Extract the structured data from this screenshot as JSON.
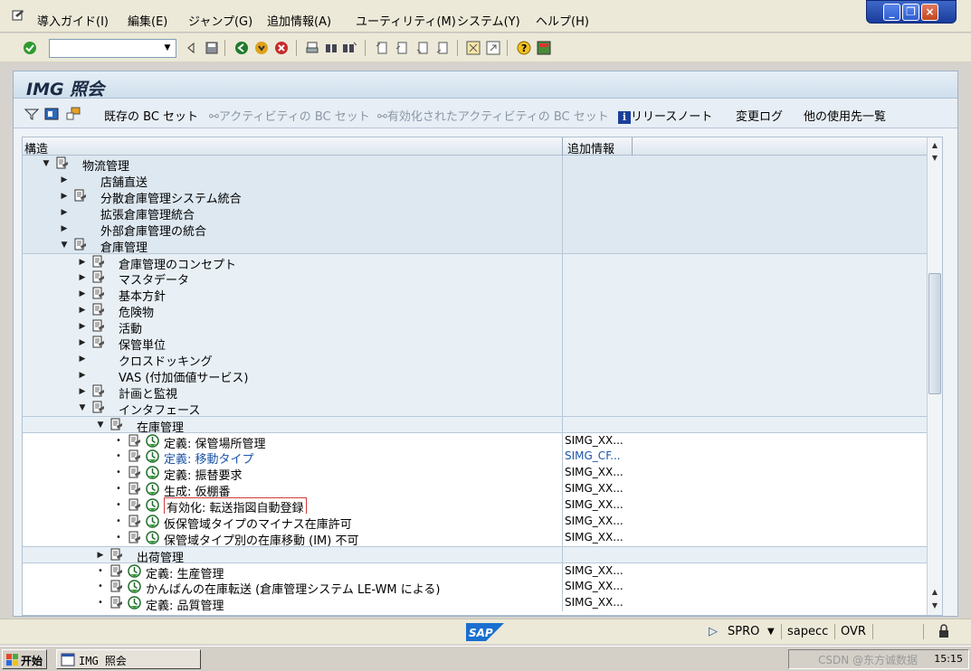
{
  "menubar": {
    "items": [
      "導入ガイド(I)",
      "編集(E)",
      "ジャンプ(G)",
      "追加情報(A)",
      "ユーティリティ(M)",
      "システム(Y)",
      "ヘルプ(H)"
    ]
  },
  "toolbar": {
    "command_value": ""
  },
  "screen": {
    "title": "IMG 照会"
  },
  "app_toolbar": {
    "existing_bc_sets": "既存の BC セット",
    "active_bc_sets": "アクティビティの BC セット",
    "activated_active_bc_sets": "有効化されたアクティビティの BC セット",
    "release_notes": "リリースノート",
    "change_log": "変更ログ",
    "where_used": "他の使用先一覧"
  },
  "tree": {
    "col_structure": "構造",
    "col_info": "追加情報",
    "rows": [
      {
        "label": "物流管理",
        "info": ""
      },
      {
        "label": "店舗直送",
        "info": ""
      },
      {
        "label": "分散倉庫管理システム統合",
        "info": ""
      },
      {
        "label": "拡張倉庫管理統合",
        "info": ""
      },
      {
        "label": "外部倉庫管理の統合",
        "info": ""
      },
      {
        "label": "倉庫管理",
        "info": ""
      },
      {
        "label": "倉庫管理のコンセプト",
        "info": ""
      },
      {
        "label": "マスタデータ",
        "info": ""
      },
      {
        "label": "基本方針",
        "info": ""
      },
      {
        "label": "危険物",
        "info": ""
      },
      {
        "label": "活動",
        "info": ""
      },
      {
        "label": "保管単位",
        "info": ""
      },
      {
        "label": "クロスドッキング",
        "info": ""
      },
      {
        "label": "VAS (付加価値サービス)",
        "info": ""
      },
      {
        "label": "計画と監視",
        "info": ""
      },
      {
        "label": "インタフェース",
        "info": ""
      },
      {
        "label": "在庫管理",
        "info": ""
      },
      {
        "label": "定義: 保管場所管理",
        "info": "SIMG_XX..."
      },
      {
        "label": "定義: 移動タイプ",
        "info": "SIMG_CF..."
      },
      {
        "label": "定義: 振替要求",
        "info": "SIMG_XX..."
      },
      {
        "label": "生成: 仮棚番",
        "info": "SIMG_XX..."
      },
      {
        "label": "有効化: 転送指図自動登録",
        "info": "SIMG_XX..."
      },
      {
        "label": "仮保管域タイプのマイナス在庫許可",
        "info": "SIMG_XX..."
      },
      {
        "label": "保管域タイプ別の在庫移動 (IM) 不可",
        "info": "SIMG_XX..."
      },
      {
        "label": "出荷管理",
        "info": ""
      },
      {
        "label": "定義: 生産管理",
        "info": "SIMG_XX..."
      },
      {
        "label": "かんばんの在庫転送 (倉庫管理システム LE-WM による)",
        "info": "SIMG_XX..."
      },
      {
        "label": "定義: 品質管理",
        "info": "SIMG_XX..."
      }
    ]
  },
  "statusbar": {
    "transaction": "SPRO",
    "server": "sapecc",
    "mode": "OVR"
  },
  "taskbar": {
    "start": "开始",
    "window": "IMG 照会",
    "tray_text": "CSDN @东方诚数据",
    "clock": "15:15"
  },
  "colors": {
    "title_bg": "#cfdfec",
    "link": "#1c55a8",
    "highlight_border": "#d23a3a"
  }
}
